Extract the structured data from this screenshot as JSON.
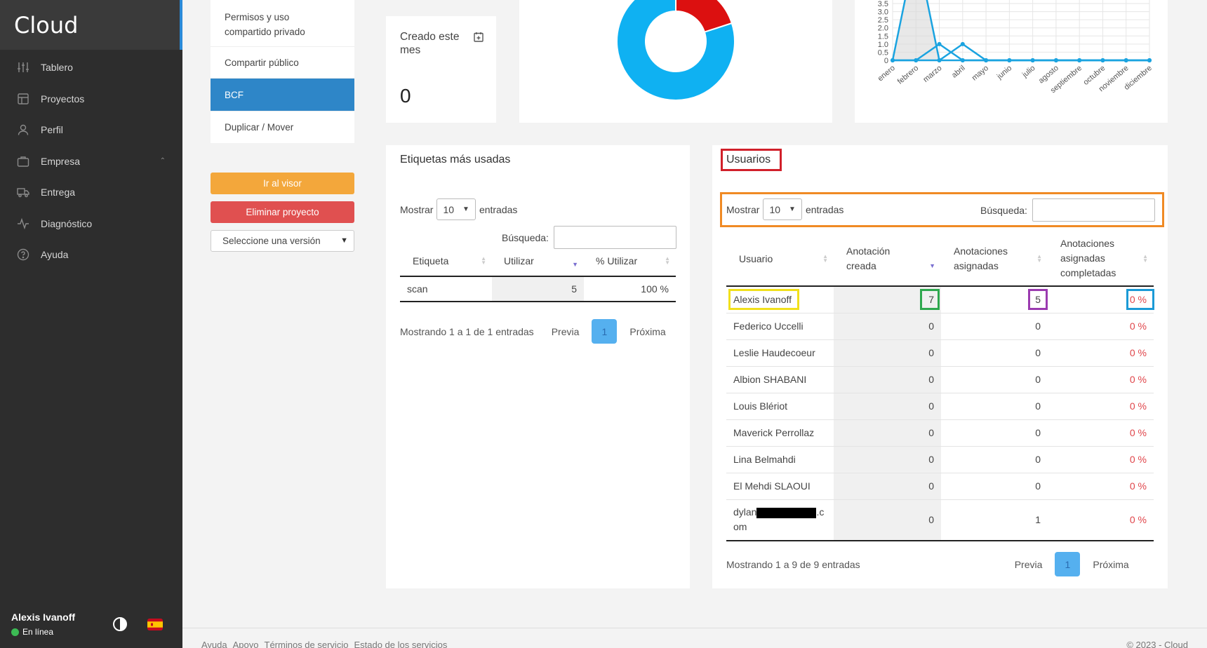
{
  "app": {
    "logo": "Cloud"
  },
  "sidebar": {
    "items": [
      {
        "label": "Tablero",
        "icon": "sliders-icon"
      },
      {
        "label": "Proyectos",
        "icon": "layout-icon"
      },
      {
        "label": "Perfil",
        "icon": "user-icon"
      },
      {
        "label": "Empresa",
        "icon": "briefcase-icon",
        "expandable": true
      },
      {
        "label": "Entrega",
        "icon": "truck-icon"
      },
      {
        "label": "Diagnóstico",
        "icon": "activity-icon"
      },
      {
        "label": "Ayuda",
        "icon": "help-circle-icon"
      }
    ],
    "user": {
      "name": "Alexis Ivanoff",
      "status": "En línea"
    }
  },
  "submenu": {
    "items": [
      {
        "label": "Permisos y uso compartido privado",
        "active": false
      },
      {
        "label": "Compartir público",
        "active": false
      },
      {
        "label": "BCF",
        "active": true
      },
      {
        "label": "Duplicar / Mover",
        "active": false
      }
    ],
    "viewer_button": "Ir al visor",
    "delete_button": "Eliminar proyecto",
    "version_select": "Seleccione una versión"
  },
  "created_card": {
    "title": "Creado este mes",
    "value": "0"
  },
  "donut": {
    "slices": [
      {
        "value": 80,
        "color": "#0fb1f2"
      },
      {
        "value": 20,
        "color": "#dc1010"
      }
    ]
  },
  "chart_data": {
    "type": "area",
    "categories": [
      "enero",
      "febrero",
      "marzo",
      "abril",
      "mayo",
      "junio",
      "julio",
      "agosto",
      "septiembre",
      "octubre",
      "noviembre",
      "diciembre"
    ],
    "y_ticks": [
      "0",
      "0.5",
      "1.0",
      "1.5",
      "2.0",
      "2.5",
      "3.0",
      "3.5"
    ],
    "ylim": [
      0,
      3.5
    ],
    "grid": true,
    "series": [
      {
        "values": [
          0,
          7,
          0,
          0,
          0,
          0,
          0,
          0,
          0,
          0,
          0,
          0
        ],
        "color": "#1aa3e0",
        "fill": "#d9d9d9"
      },
      {
        "values": [
          0,
          0,
          1,
          0,
          0,
          0,
          0,
          0,
          0,
          0,
          0,
          0
        ],
        "color": "#1aa3e0",
        "fill": "none"
      },
      {
        "values": [
          0,
          0,
          0,
          1,
          0,
          0,
          0,
          0,
          0,
          0,
          0,
          0
        ],
        "color": "#1aa3e0",
        "fill": "none"
      }
    ]
  },
  "tags_table": {
    "title": "Etiquetas más usadas",
    "show_label": "Mostrar",
    "entries_label": "entradas",
    "page_size": "10",
    "search_label": "Búsqueda:",
    "columns": [
      "Etiqueta",
      "Utilizar",
      "% Utilizar"
    ],
    "rows": [
      {
        "tag": "scan",
        "uses": "5",
        "pct": "100 %"
      }
    ],
    "info": "Mostrando 1 a 1 de 1 entradas",
    "prev": "Previa",
    "page": "1",
    "next": "Próxima"
  },
  "users_table": {
    "title": "Usuarios",
    "show_label": "Mostrar",
    "entries_label": "entradas",
    "page_size": "10",
    "search_label": "Búsqueda:",
    "columns": [
      "Usuario",
      "Anotación creada",
      "Anotaciones asignadas",
      "Anotaciones asignadas completadas"
    ],
    "rows": [
      {
        "user": "Alexis Ivanoff",
        "created": "7",
        "assigned": "5",
        "completed": "0 %"
      },
      {
        "user": "Federico Uccelli",
        "created": "0",
        "assigned": "0",
        "completed": "0 %"
      },
      {
        "user": "Leslie Haudecoeur",
        "created": "0",
        "assigned": "0",
        "completed": "0 %"
      },
      {
        "user": "Albion SHABANI",
        "created": "0",
        "assigned": "0",
        "completed": "0 %"
      },
      {
        "user": "Louis Blériot",
        "created": "0",
        "assigned": "0",
        "completed": "0 %"
      },
      {
        "user": "Maverick Perrollaz",
        "created": "0",
        "assigned": "0",
        "completed": "0 %"
      },
      {
        "user": "Lina Belmahdi",
        "created": "0",
        "assigned": "0",
        "completed": "0 %"
      },
      {
        "user": "El Mehdi SLAOUI",
        "created": "0",
        "assigned": "0",
        "completed": "0 %"
      },
      {
        "user_prefix": "dylan",
        "user_suffix": ".c",
        "user_line2": "om",
        "created": "0",
        "assigned": "1",
        "completed": "0 %"
      }
    ],
    "info": "Mostrando 1 a 9 de 9 entradas",
    "prev": "Previa",
    "page": "1",
    "next": "Próxima"
  },
  "footer": {
    "links": [
      "Ayuda",
      "Apoyo",
      "Términos de servicio",
      "Estado de los servicios"
    ],
    "copyright": "© 2023 - Cloud"
  },
  "highlights": {
    "title": "#d1202a",
    "controls": "#f08a24",
    "user": "#f1e01c",
    "created": "#2fa84f",
    "assigned": "#9b3bb0",
    "completed": "#1b9ad6"
  }
}
